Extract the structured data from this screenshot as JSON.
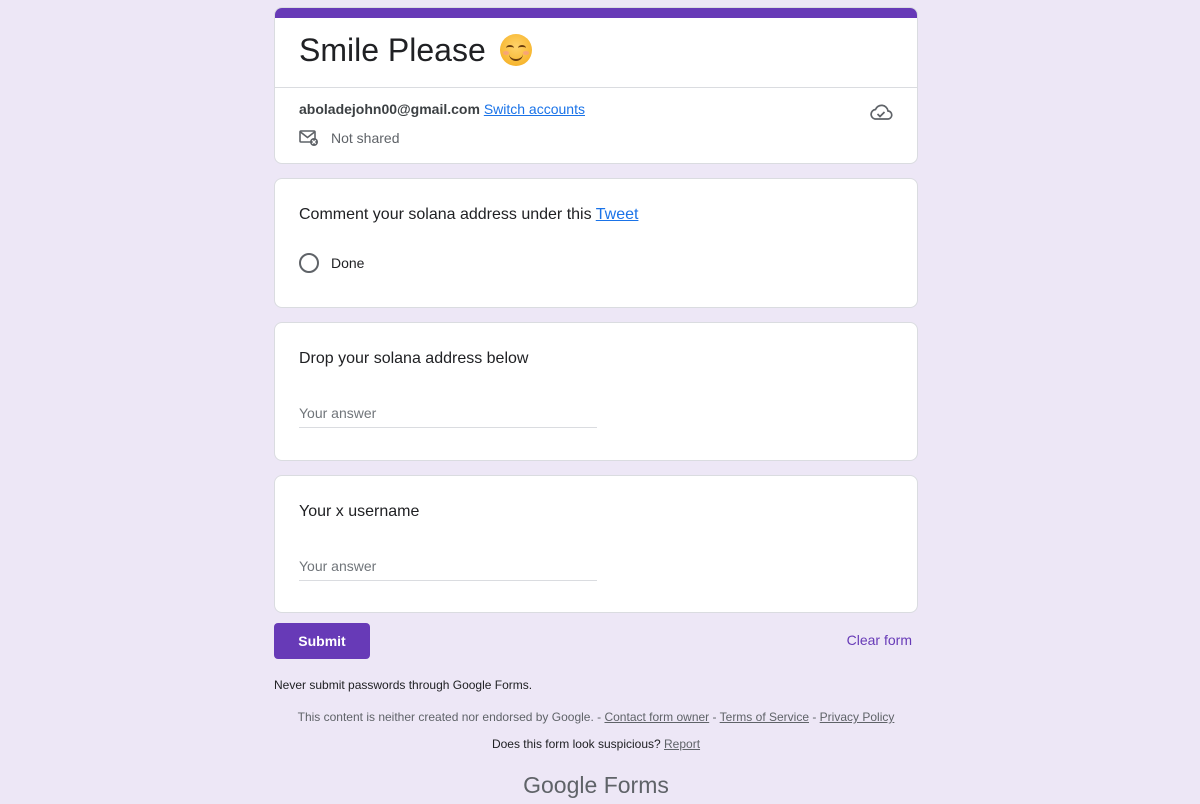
{
  "form": {
    "title": "Smile Please",
    "title_emoji": "smiling-face-emoji",
    "account_email": "aboladejohn00@gmail.com",
    "switch_accounts": "Switch accounts",
    "not_shared": "Not shared"
  },
  "questions": [
    {
      "label_prefix": "Comment your solana address under this ",
      "label_link": "Tweet",
      "option": "Done"
    },
    {
      "label": "Drop your solana address below",
      "placeholder": "Your answer"
    },
    {
      "label": "Your x username",
      "placeholder": "Your answer"
    }
  ],
  "actions": {
    "submit": "Submit",
    "clear": "Clear form"
  },
  "footer": {
    "warning": "Never submit passwords through Google Forms.",
    "disclaimer": "This content is neither created nor endorsed by Google. - ",
    "contact": "Contact form owner",
    "sep1": " - ",
    "terms": "Terms of Service",
    "sep2": " - ",
    "privacy": "Privacy Policy",
    "suspicious": "Does this form look suspicious? ",
    "report": "Report",
    "brand_google": "Google",
    "brand_forms": "Forms"
  },
  "colors": {
    "accent": "#673ab7",
    "background": "#ede7f6",
    "link": "#1a73e8"
  }
}
